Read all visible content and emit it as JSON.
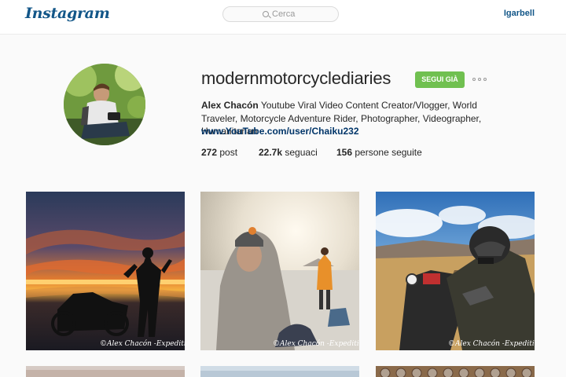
{
  "header": {
    "logo_text": "Instagram",
    "search_placeholder": "Cerca",
    "current_user": "Igarbell"
  },
  "profile": {
    "username": "modernmotorcyclediaries",
    "follow_label": "SEGUI GIÀ",
    "full_name": "Alex Chacón",
    "bio": "Youtube Viral Video Content Creator/Vlogger, World Traveler, Motorcycle Adventure Rider, Photographer, Videographer, Humanitarian",
    "link": "www.YouTube.com/user/Chaiku232",
    "stats": {
      "posts_count": "272",
      "posts_label": "post",
      "followers_count": "22.7k",
      "followers_label": "seguaci",
      "following_count": "156",
      "following_label": "persone seguite"
    }
  },
  "posts": [
    {
      "watermark": "©Alex Chacón -Expedition"
    },
    {
      "watermark": "©Alex Chacón -ExpeditionSo"
    },
    {
      "watermark": "©Alex Chacón -ExpeditionSo"
    }
  ],
  "colors": {
    "brand": "#125688",
    "follow_button": "#70c050",
    "link": "#003569"
  },
  "icons": [
    "search-icon",
    "more-options-icon"
  ]
}
